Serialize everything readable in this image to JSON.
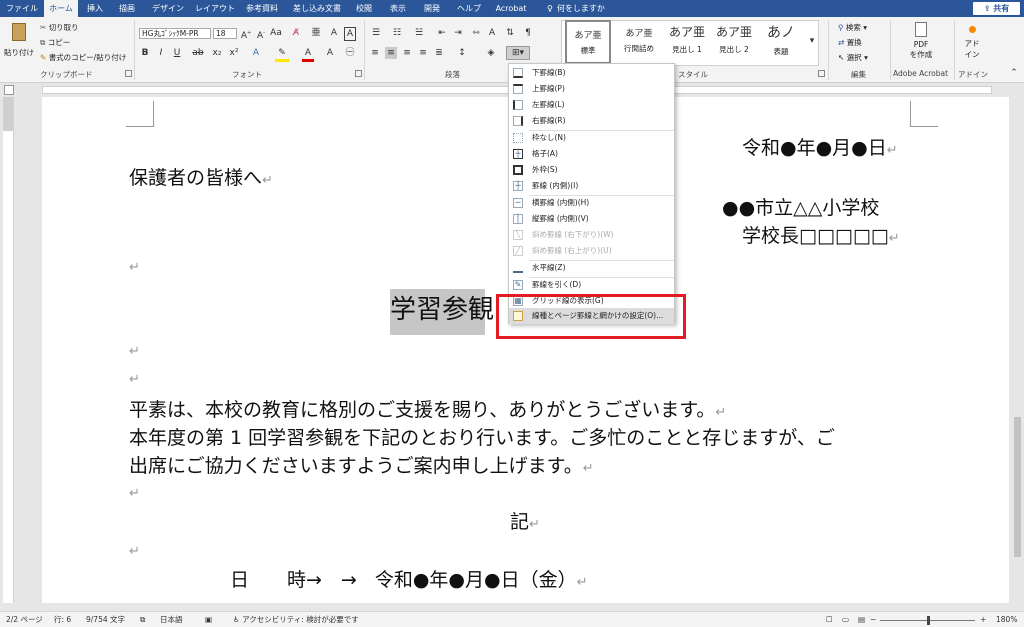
{
  "tabs": [
    {
      "label": "ファイル",
      "active": false
    },
    {
      "label": "ホーム",
      "active": true
    },
    {
      "label": "挿入",
      "active": false
    },
    {
      "label": "描画",
      "active": false
    },
    {
      "label": "デザイン",
      "active": false
    },
    {
      "label": "レイアウト",
      "active": false
    },
    {
      "label": "参考資料",
      "active": false
    },
    {
      "label": "差し込み文書",
      "active": false
    },
    {
      "label": "校閲",
      "active": false
    },
    {
      "label": "表示",
      "active": false
    },
    {
      "label": "開発",
      "active": false
    },
    {
      "label": "ヘルプ",
      "active": false
    },
    {
      "label": "Acrobat",
      "active": false
    }
  ],
  "tell_me": "何をしますか",
  "share": "共有",
  "ribbon": {
    "clipboard": {
      "paste": "貼り付け",
      "cut": "切り取り",
      "copy": "コピー",
      "format_painter": "書式のコピー/貼り付け",
      "label": "クリップボード"
    },
    "font": {
      "name": "HG丸ｺﾞｼｯｸM-PR",
      "size": "18",
      "label": "フォント"
    },
    "paragraph": {
      "label": "段落"
    },
    "styles": {
      "items": [
        {
          "sample": "あア亜",
          "name": "標準"
        },
        {
          "sample": "あア亜",
          "name": "行間詰め"
        },
        {
          "sample": "あア亜",
          "name": "見出し 1"
        },
        {
          "sample": "あア亜",
          "name": "見出し 2"
        },
        {
          "sample": "あノ",
          "name": "表題"
        }
      ],
      "label": "スタイル"
    },
    "editing": {
      "find": "検索",
      "replace": "置換",
      "select": "選択",
      "label": "編集"
    },
    "acrobat": {
      "button": "PDF を作成",
      "line1": "PDF",
      "line2": "を作成",
      "label": "Adobe Acrobat"
    },
    "addins": {
      "line1": "アド",
      "line2": "イン",
      "label": "アドイン"
    }
  },
  "border_menu": {
    "items": [
      {
        "icon": "border-bottom-icon",
        "label": "下罫線(B)",
        "disabled": false
      },
      {
        "icon": "border-top-icon",
        "label": "上罫線(P)",
        "disabled": false
      },
      {
        "icon": "border-left-icon",
        "label": "左罫線(L)",
        "disabled": false
      },
      {
        "icon": "border-right-icon",
        "label": "右罫線(R)",
        "disabled": false
      },
      {
        "icon": "border-none-icon",
        "label": "枠なし(N)",
        "disabled": false
      },
      {
        "icon": "border-all-icon",
        "label": "格子(A)",
        "disabled": false
      },
      {
        "icon": "border-outside-icon",
        "label": "外枠(S)",
        "disabled": false
      },
      {
        "icon": "border-inside-icon",
        "label": "罫線 (内側)(I)",
        "disabled": false
      },
      {
        "icon": "border-inside-horizontal-icon",
        "label": "横罫線 (内側)(H)",
        "disabled": false
      },
      {
        "icon": "border-inside-vertical-icon",
        "label": "縦罫線 (内側)(V)",
        "disabled": false
      },
      {
        "icon": "border-diagonal-down-icon",
        "label": "斜め罫線 (右下がり)(W)",
        "disabled": true
      },
      {
        "icon": "border-diagonal-up-icon",
        "label": "斜め罫線 (右上がり)(U)",
        "disabled": true
      },
      {
        "icon": "horizontal-line-icon",
        "label": "水平線(Z)",
        "disabled": false
      },
      {
        "icon": "draw-table-icon",
        "label": "罫線を引く(D)",
        "disabled": false
      },
      {
        "icon": "view-gridlines-icon",
        "label": "グリッド線の表示(G)",
        "disabled": false
      },
      {
        "icon": "borders-and-shading-icon",
        "label": "線種とページ罫線と網かけの設定(O)...",
        "disabled": false
      }
    ]
  },
  "document": {
    "date": "令和●年●月●日",
    "greeting": "保護者の皆様へ",
    "school": "●●市立△△小学校",
    "principal": "学校長□□□□□",
    "title": "学習参観",
    "body1": "平素は、本校の教育に格別のご支援を賜り、ありがとうございます。",
    "body2": "本年度の第 1 回学習参観を下記のとおり行います。ご多忙のことと存じますが、ご",
    "body3": "出席にご協力くださいますようご案内申し上げます。",
    "ki": "記",
    "datetime_label": "日　　時→　→",
    "datetime_value": "令和●年●月●日（金）",
    "para_mark": "↵"
  },
  "status": {
    "page": "2/2 ページ",
    "line": "行: 6",
    "words": "9/754 文字",
    "language": "日本語",
    "accessibility": "アクセシビリティ: 検討が必要です",
    "zoom": "180%"
  }
}
